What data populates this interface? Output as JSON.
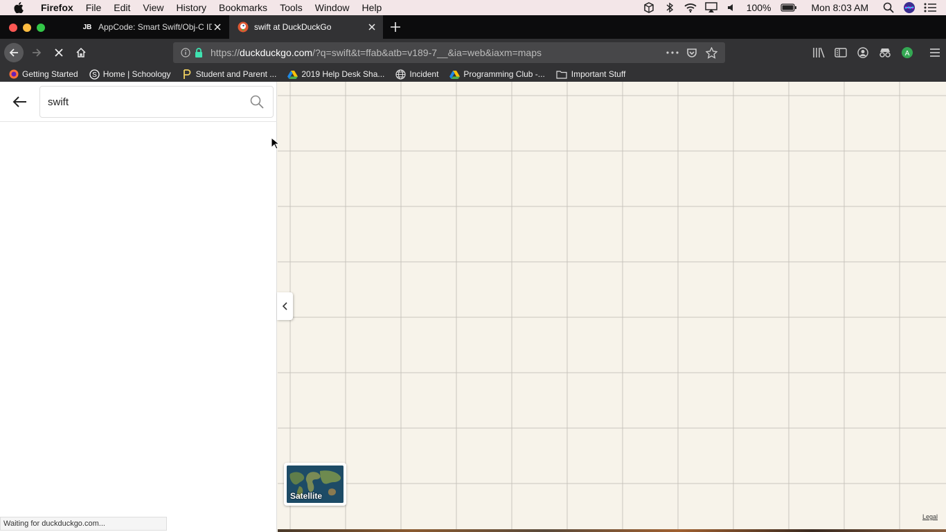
{
  "menubar": {
    "app_name": "Firefox",
    "items": [
      "File",
      "Edit",
      "View",
      "History",
      "Bookmarks",
      "Tools",
      "Window",
      "Help"
    ],
    "battery": "100%",
    "clock": "Mon 8:03 AM"
  },
  "tabs": [
    {
      "favicon_text": "JB",
      "title": "AppCode: Smart Swift/Obj-C ID",
      "active": false
    },
    {
      "favicon_text": "",
      "title": "swift at DuckDuckGo",
      "active": true
    }
  ],
  "urlbar": {
    "prefix": "https://",
    "domain": "duckduckgo.com",
    "path": "/?q=swift&t=ffab&atb=v189-7__&ia=web&iaxm=maps"
  },
  "bookmarks": [
    {
      "icon": "firefox-icon",
      "label": "Getting Started"
    },
    {
      "icon": "schoology-icon",
      "label": "Home | Schoology"
    },
    {
      "icon": "powerschool-icon",
      "label": "Student and Parent ..."
    },
    {
      "icon": "google-drive-icon",
      "label": "2019 Help Desk Sha..."
    },
    {
      "icon": "globe-icon",
      "label": "Incident"
    },
    {
      "icon": "google-drive-icon",
      "label": "Programming Club -..."
    },
    {
      "icon": "folder-icon",
      "label": "Important Stuff"
    }
  ],
  "search": {
    "value": "swift"
  },
  "map": {
    "satellite_label": "Satellite",
    "legal_label": "Legal",
    "grid_color": "#c9c5bd",
    "background": "#f7f3ea"
  },
  "status": {
    "text": "Waiting for duckduckgo.com..."
  }
}
